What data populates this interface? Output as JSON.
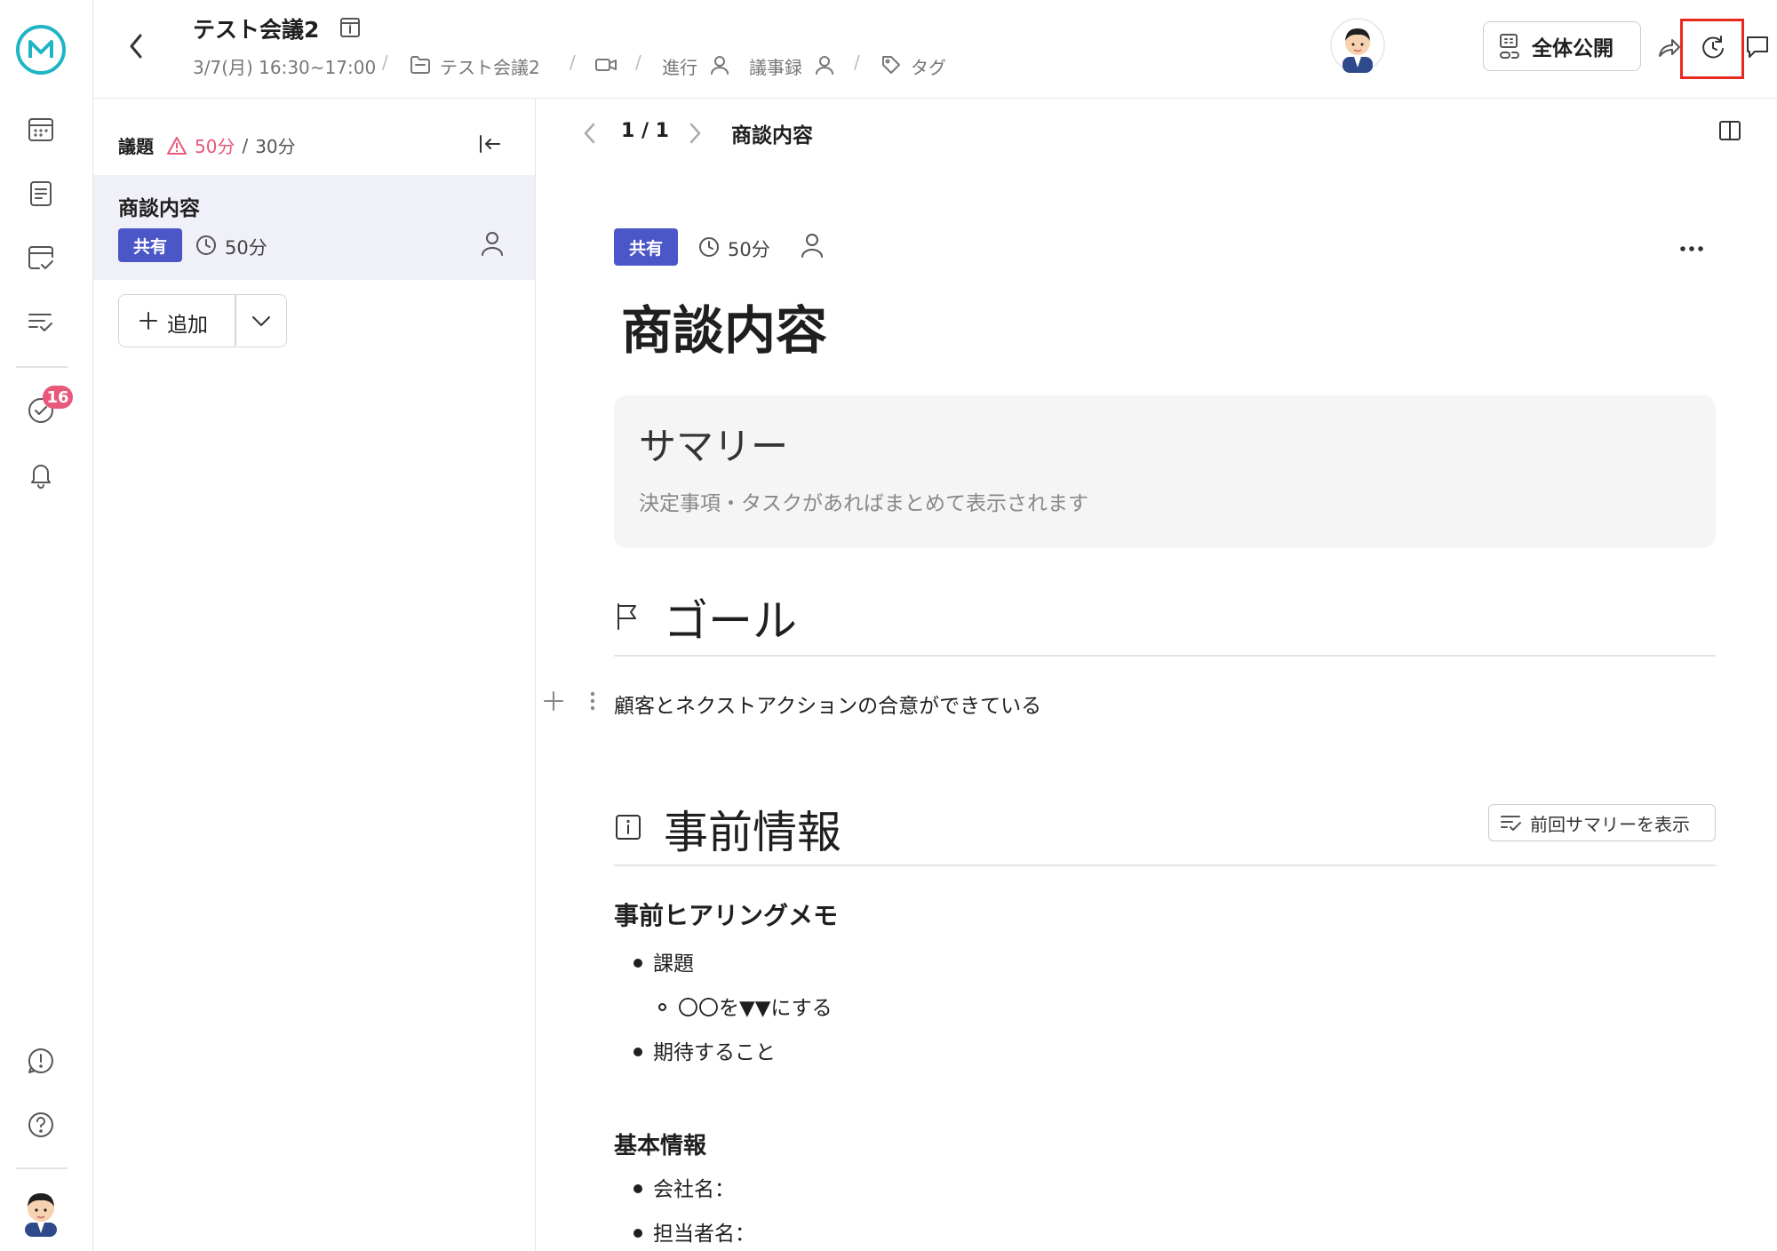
{
  "header": {
    "meeting_title": "テスト会議2",
    "datetime": "3/7(月) 16:30~17:00",
    "folder": "テスト会議2",
    "facilitator_label": "進行",
    "minutes_label": "議事録",
    "tag_label": "タグ",
    "public_label": "全体公開",
    "separator": "/"
  },
  "rail": {
    "badge_count": "16",
    "accent_color": "#1fb5c4"
  },
  "agenda": {
    "label": "議題",
    "over_time": "50分",
    "separator": "/",
    "planned_time": "30分",
    "items": [
      {
        "title": "商談内容",
        "tag": "共有",
        "duration": "50分"
      }
    ],
    "add_label": "追加"
  },
  "doc": {
    "pager": "1 / 1",
    "breadcrumb_title": "商談内容",
    "tag": "共有",
    "duration": "50分",
    "title": "商談内容",
    "summary": {
      "heading": "サマリー",
      "placeholder": "決定事項・タスクがあればまとめて表示されます"
    },
    "goal": {
      "heading": "ゴール",
      "text": "顧客とネクストアクションの合意ができている"
    },
    "prior_info": {
      "heading": "事前情報",
      "prev_summary_button": "前回サマリーを表示",
      "hearing": {
        "heading": "事前ヒアリングメモ",
        "items": [
          "課題",
          "〇〇を▼▼にする",
          "期待すること"
        ]
      },
      "basic": {
        "heading": "基本情報",
        "items": [
          "会社名：",
          "担当者名："
        ]
      }
    }
  },
  "colors": {
    "share_tag": "#4b56c8",
    "warning": "#e8587a",
    "highlight": "#e8291e"
  }
}
